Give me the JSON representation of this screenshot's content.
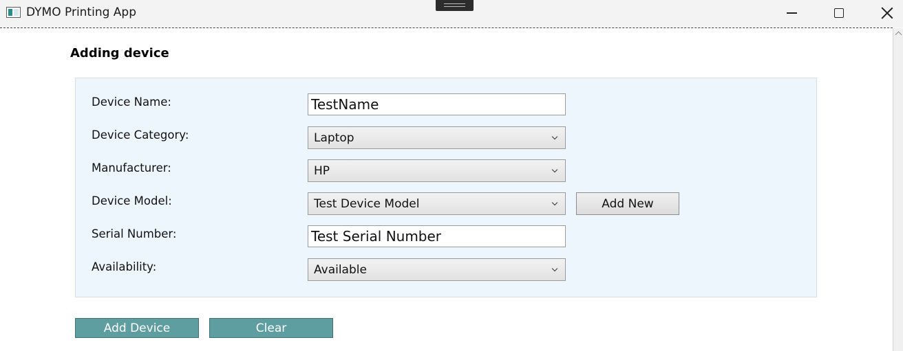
{
  "window": {
    "title": "DYMO Printing App",
    "icons": {
      "app": "app-window-icon",
      "minimize": "minimize-icon",
      "maximize": "maximize-icon",
      "close": "close-icon"
    }
  },
  "page": {
    "heading": "Adding device"
  },
  "form": {
    "device_name": {
      "label": "Device Name:",
      "value": "TestName"
    },
    "device_category": {
      "label": "Device Category:",
      "value": "Laptop"
    },
    "manufacturer": {
      "label": "Manufacturer:",
      "value": "HP"
    },
    "device_model": {
      "label": "Device Model:",
      "value": "Test Device Model",
      "add_new_label": "Add New"
    },
    "serial_number": {
      "label": "Serial Number:",
      "value": "Test Serial Number"
    },
    "availability": {
      "label": "Availability:",
      "value": "Available"
    }
  },
  "actions": {
    "add_device_label": "Add Device",
    "clear_label": "Clear"
  },
  "colors": {
    "panel_background": "#eef6fd",
    "action_button": "#5f9ea0"
  }
}
